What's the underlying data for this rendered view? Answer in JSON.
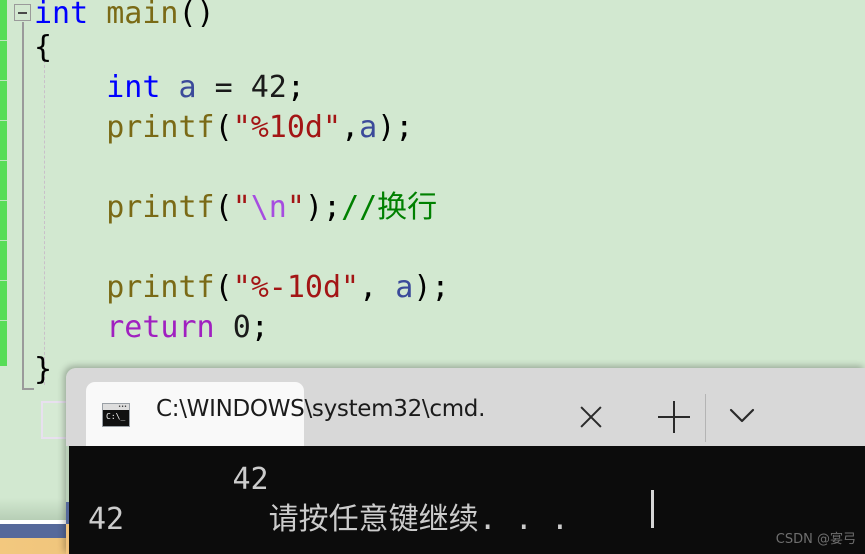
{
  "editor": {
    "language": "c",
    "background_color": "#d2e8d0",
    "change_marker_color": "#57dd57",
    "collapse_icon": "minus-collapse-icon",
    "lines": [
      {
        "indent": 0,
        "tokens": [
          {
            "text": "int",
            "cls": "kw-blue"
          },
          {
            "text": " ",
            "cls": "plain"
          },
          {
            "text": "main",
            "cls": "fn-olive"
          },
          {
            "text": "()",
            "cls": "punct"
          }
        ]
      },
      {
        "indent": 0,
        "tokens": [
          {
            "text": "{",
            "cls": "punct"
          }
        ]
      },
      {
        "indent": 0,
        "tokens": []
      },
      {
        "indent": 0,
        "tokens": [
          {
            "text": "    ",
            "cls": "plain"
          },
          {
            "text": "int",
            "cls": "kw-blue"
          },
          {
            "text": " ",
            "cls": "plain"
          },
          {
            "text": "a",
            "cls": "ident-blue"
          },
          {
            "text": " = ",
            "cls": "plain"
          },
          {
            "text": "42",
            "cls": "plain"
          },
          {
            "text": ";",
            "cls": "punct"
          }
        ]
      },
      {
        "indent": 0,
        "tokens": [
          {
            "text": "    ",
            "cls": "plain"
          },
          {
            "text": "printf",
            "cls": "fn-olive"
          },
          {
            "text": "(",
            "cls": "punct"
          },
          {
            "text": "\"%10d\"",
            "cls": "str-red"
          },
          {
            "text": ",",
            "cls": "punct"
          },
          {
            "text": "a",
            "cls": "ident-blue"
          },
          {
            "text": ");",
            "cls": "punct"
          }
        ]
      },
      {
        "indent": 0,
        "tokens": []
      },
      {
        "indent": 0,
        "tokens": [
          {
            "text": "    ",
            "cls": "plain"
          },
          {
            "text": "printf",
            "cls": "fn-olive"
          },
          {
            "text": "(",
            "cls": "punct"
          },
          {
            "text": "\"",
            "cls": "str-red"
          },
          {
            "text": "\\n",
            "cls": "esc-purple"
          },
          {
            "text": "\"",
            "cls": "str-red"
          },
          {
            "text": ");",
            "cls": "punct"
          },
          {
            "text": "//换行",
            "cls": "comment-gr"
          }
        ]
      },
      {
        "indent": 0,
        "tokens": []
      },
      {
        "indent": 0,
        "tokens": [
          {
            "text": "    ",
            "cls": "plain"
          },
          {
            "text": "printf",
            "cls": "fn-olive"
          },
          {
            "text": "(",
            "cls": "punct"
          },
          {
            "text": "\"%-10d\"",
            "cls": "str-red"
          },
          {
            "text": ", ",
            "cls": "punct"
          },
          {
            "text": "a",
            "cls": "ident-blue"
          },
          {
            "text": ");",
            "cls": "punct"
          }
        ]
      },
      {
        "indent": 0,
        "tokens": [
          {
            "text": "    ",
            "cls": "plain"
          },
          {
            "text": "return",
            "cls": "kw-purple"
          },
          {
            "text": " ",
            "cls": "plain"
          },
          {
            "text": "0",
            "cls": "plain"
          },
          {
            "text": ";",
            "cls": "punct"
          }
        ]
      },
      {
        "indent": 0,
        "tokens": [
          {
            "text": "}",
            "cls": "punct"
          }
        ]
      }
    ]
  },
  "terminal": {
    "tab": {
      "title": "C:\\WINDOWS\\system32\\cmd.",
      "icon": "cmd-console-icon",
      "icon_prompt": "C:\\_",
      "close_label": "Close tab",
      "new_tab_label": "New tab",
      "dropdown_label": "Open new tab dropdown"
    },
    "background_color": "#0c0c0c",
    "foreground_color": "#cccccc",
    "output_lines": [
      "        42",
      "42        请按任意键继续. . ."
    ],
    "cursor_visible": true
  },
  "watermark": {
    "text": "CSDN @宴弓"
  },
  "status_strips": {
    "blue_color": "#56699b",
    "orange_color": "#f0c27d"
  }
}
